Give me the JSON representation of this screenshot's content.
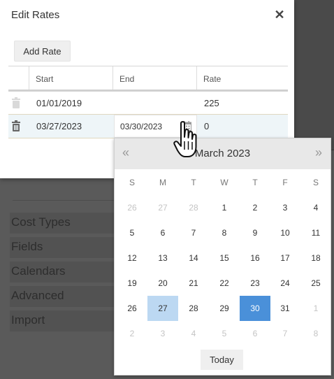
{
  "background": {
    "nav_items": [
      "Cost Types",
      "Fields",
      "Calendars",
      "Advanced",
      "Import"
    ]
  },
  "dialog": {
    "title": "Edit Rates",
    "close_icon": "close-icon",
    "add_rate_label": "Add Rate",
    "columns": [
      "Start",
      "End",
      "Rate"
    ],
    "rows": [
      {
        "start": "01/01/2019",
        "end": "",
        "rate": "225",
        "delete_icon": "trash-icon",
        "enabled": false
      },
      {
        "start": "03/27/2023",
        "end": "03/30/2023",
        "rate": "0",
        "delete_icon": "trash-icon",
        "enabled": true
      }
    ],
    "end_picker_icon": "calendar-icon"
  },
  "datepicker": {
    "prev_glyph": "«",
    "next_glyph": "»",
    "month_label": "March 2023",
    "weekdays": [
      "S",
      "M",
      "T",
      "W",
      "T",
      "F",
      "S"
    ],
    "weeks": [
      [
        "26",
        "27",
        "28",
        "1",
        "2",
        "3",
        "4"
      ],
      [
        "5",
        "6",
        "7",
        "8",
        "9",
        "10",
        "11"
      ],
      [
        "12",
        "13",
        "14",
        "15",
        "16",
        "17",
        "18"
      ],
      [
        "19",
        "20",
        "21",
        "22",
        "23",
        "24",
        "25"
      ],
      [
        "26",
        "27",
        "28",
        "29",
        "30",
        "31",
        "1"
      ],
      [
        "2",
        "3",
        "4",
        "5",
        "6",
        "7",
        "8"
      ]
    ],
    "range_start": "27",
    "selected": "30",
    "today_label": "Today"
  },
  "colors": {
    "accent": "#4a90d9",
    "range_fill": "#bcd8f2",
    "overlay": "#5a5a5a"
  }
}
